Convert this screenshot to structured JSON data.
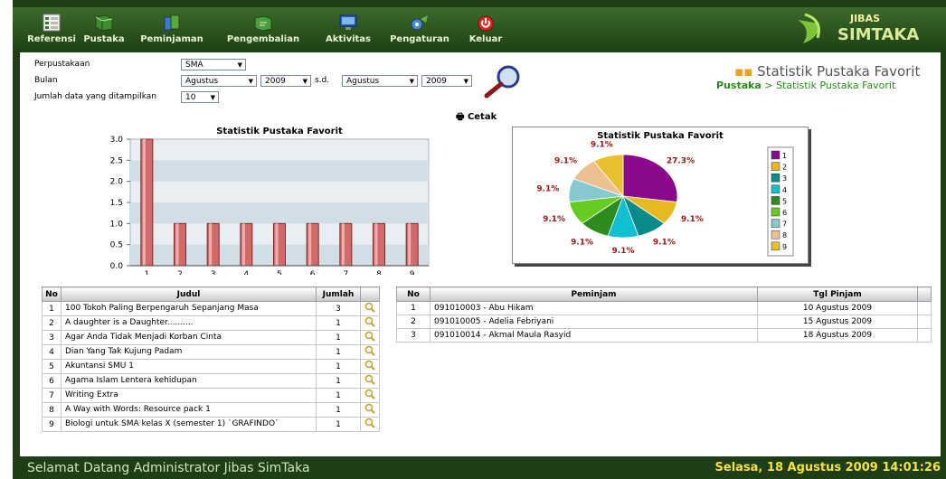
{
  "menu": [
    {
      "label": "Referensi",
      "icon": "list-icon"
    },
    {
      "label": "Pustaka",
      "icon": "book-icon"
    },
    {
      "label": "Peminjaman",
      "icon": "borrow-icon"
    },
    {
      "label": "Pengembalian",
      "icon": "return-icon"
    },
    {
      "label": "Aktivitas",
      "icon": "monitor-icon"
    },
    {
      "label": "Pengaturan",
      "icon": "settings-icon"
    },
    {
      "label": "Keluar",
      "icon": "power-icon"
    }
  ],
  "logo": {
    "top": "JIBAS",
    "bottom": "SIMTAKA"
  },
  "filters": {
    "perpustakaan_label": "Perpustakaan",
    "perpustakaan_value": "SMA",
    "bulan_label": "Bulan",
    "bulan_from_month": "Agustus",
    "bulan_from_year": "2009",
    "sd": "s.d.",
    "bulan_to_month": "Agustus",
    "bulan_to_year": "2009",
    "jumlah_label": "Jumlah data yang ditampilkan",
    "jumlah_value": "10"
  },
  "heading": {
    "title": "Statistik Pustaka Favorit",
    "crumb_root": "Pustaka",
    "crumb_sep": ">",
    "crumb_current": "Statistik Pustaka Favorit"
  },
  "print_label": "Cetak",
  "chart_data": [
    {
      "type": "bar",
      "title": "Statistik Pustaka Favorit",
      "categories": [
        "1",
        "2",
        "3",
        "4",
        "5",
        "6",
        "7",
        "8",
        "9"
      ],
      "values": [
        3,
        1,
        1,
        1,
        1,
        1,
        1,
        1,
        1
      ],
      "ylim": [
        0,
        3.0
      ],
      "yticks": [
        "0.0",
        "0.5",
        "1.0",
        "1.5",
        "2.0",
        "2.5",
        "3.0"
      ],
      "grid": true
    },
    {
      "type": "pie",
      "title": "Statistik Pustaka Favorit",
      "labels": [
        "1",
        "2",
        "3",
        "4",
        "5",
        "6",
        "7",
        "8",
        "9"
      ],
      "values": [
        27.3,
        9.1,
        9.1,
        9.1,
        9.1,
        9.1,
        9.1,
        9.1,
        9.1
      ],
      "value_labels": [
        "27.3%",
        "9.1%",
        "9.1%",
        "9.1%",
        "9.1%",
        "9.1%",
        "9.1%",
        "9.1%",
        "9.1%"
      ],
      "colors": [
        "#8b0a8b",
        "#e8b820",
        "#0a8a8a",
        "#10c0d0",
        "#2e8b1e",
        "#66cc22",
        "#88c8d0",
        "#ecc090",
        "#e8c030"
      ],
      "legend": "right"
    }
  ],
  "books_table": {
    "headers": [
      "No",
      "Judul",
      "Jumlah",
      ""
    ],
    "rows": [
      {
        "no": "1",
        "judul": "100 Tokoh Paling Berpengaruh Sepanjang Masa",
        "jumlah": "3"
      },
      {
        "no": "2",
        "judul": "A daughter is a Daughter..........",
        "jumlah": "1"
      },
      {
        "no": "3",
        "judul": "Agar Anda Tidak Menjadi Korban Cinta",
        "jumlah": "1"
      },
      {
        "no": "4",
        "judul": "Dian Yang Tak Kujung Padam",
        "jumlah": "1"
      },
      {
        "no": "5",
        "judul": "Akuntansi SMU 1",
        "jumlah": "1"
      },
      {
        "no": "6",
        "judul": "Agama Islam Lentera kehidupan",
        "jumlah": "1"
      },
      {
        "no": "7",
        "judul": "Writing Extra",
        "jumlah": "1"
      },
      {
        "no": "8",
        "judul": "A Way with Words: Resource pack 1",
        "jumlah": "1"
      },
      {
        "no": "9",
        "judul": "Biologi untuk SMA kelas X (semester 1) `GRAFINDO`",
        "jumlah": "1"
      }
    ]
  },
  "borrowers_table": {
    "headers": [
      "No",
      "Peminjam",
      "Tgl Pinjam",
      ""
    ],
    "rows": [
      {
        "no": "1",
        "peminjam": "091010003 - Abu Hikam",
        "tgl": "10 Agustus 2009"
      },
      {
        "no": "2",
        "peminjam": "091010005 - Adelia Febriyani",
        "tgl": "15 Agustus 2009"
      },
      {
        "no": "3",
        "peminjam": "091010014 - Akmal Maula Rasyid",
        "tgl": "18 Agustus 2009"
      }
    ]
  },
  "footer": {
    "welcome": "Selamat Datang Administrator Jibas SimTaka",
    "datetime": "Selasa, 18 Agustus 2009 14:01:26"
  },
  "colors": {
    "header_bg": "#2a5520",
    "footer_date": "#f5e23a",
    "bar_fill": "#d26a6a",
    "breadcrumb_green": "#2a8a1a"
  }
}
